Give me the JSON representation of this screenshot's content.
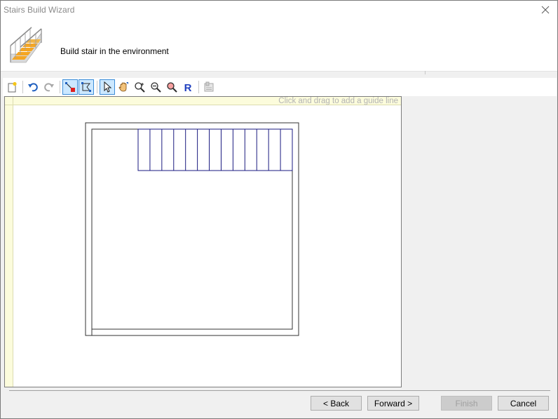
{
  "window": {
    "title": "Stairs Build Wizard"
  },
  "header": {
    "text": "Build stair in the environment",
    "icon": "stair-icon"
  },
  "toolbar": {
    "buttons": [
      {
        "name": "new-icon",
        "active": false
      },
      {
        "name": "undo-icon",
        "active": false
      },
      {
        "name": "redo-icon",
        "active": false
      },
      {
        "name": "draw-node-icon",
        "active": true
      },
      {
        "name": "draw-polygon-icon",
        "active": true
      },
      {
        "name": "select-pointer-icon",
        "active": true
      },
      {
        "name": "pan-hand-icon",
        "active": false
      },
      {
        "name": "zoom-in-icon",
        "active": false
      },
      {
        "name": "zoom-out-icon",
        "active": false
      },
      {
        "name": "zoom-fit-icon",
        "active": false
      },
      {
        "name": "reset-view-icon",
        "active": false
      },
      {
        "name": "properties-icon",
        "active": false
      }
    ],
    "reset_label": "R"
  },
  "canvas": {
    "hint": "Click and drag to add a guide line",
    "tread_count": 13
  },
  "footer": {
    "back_label": "< Back",
    "forward_label": "Forward >",
    "finish_label": "Finish",
    "cancel_label": "Cancel"
  },
  "colors": {
    "accent": "#3c8dd8",
    "ruler": "#fcfcdc",
    "stair_line": "#1a1a80",
    "wall_line": "#333333"
  }
}
